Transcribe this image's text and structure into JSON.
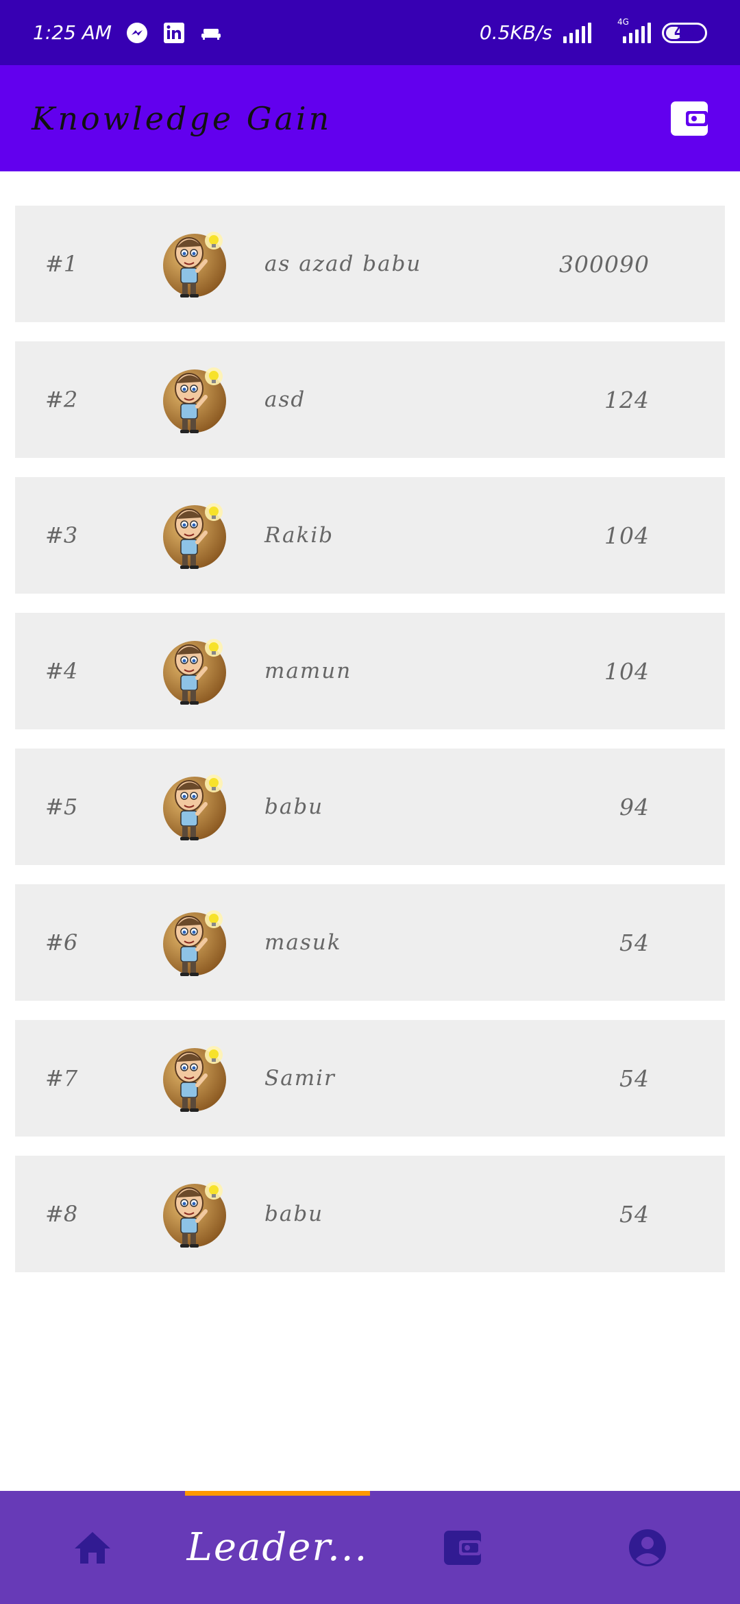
{
  "status_bar": {
    "time": "1:25 AM",
    "net_speed": "0.5KB/s",
    "network_type": "4G",
    "battery": "48",
    "battery_level": 0.48,
    "icons": [
      "messenger-icon",
      "linkedin-icon",
      "sofa-icon",
      "signal-icon",
      "signal-4g-icon",
      "battery-icon"
    ]
  },
  "app_bar": {
    "title": "Knowledge Gain",
    "action_icon": "wallet-icon",
    "color": "#6200EE"
  },
  "leaderboard": [
    {
      "rank": "#1",
      "name": "as azad babu",
      "score": "300090"
    },
    {
      "rank": "#2",
      "name": "asd",
      "score": "124"
    },
    {
      "rank": "#3",
      "name": "Rakib",
      "score": "104"
    },
    {
      "rank": "#4",
      "name": "mamun",
      "score": "104"
    },
    {
      "rank": "#5",
      "name": "babu",
      "score": "94"
    },
    {
      "rank": "#6",
      "name": "masuk",
      "score": "54"
    },
    {
      "rank": "#7",
      "name": "Samir",
      "score": "54"
    },
    {
      "rank": "#8",
      "name": "babu",
      "score": "54"
    }
  ],
  "bottom_nav": {
    "items": [
      {
        "icon": "home-icon",
        "label": ""
      },
      {
        "icon": "",
        "label": "Leader..."
      },
      {
        "icon": "wallet-icon",
        "label": ""
      },
      {
        "icon": "account-icon",
        "label": ""
      }
    ],
    "active_index": 1,
    "color": "#673AB7",
    "indicator_color": "#FF9800"
  }
}
